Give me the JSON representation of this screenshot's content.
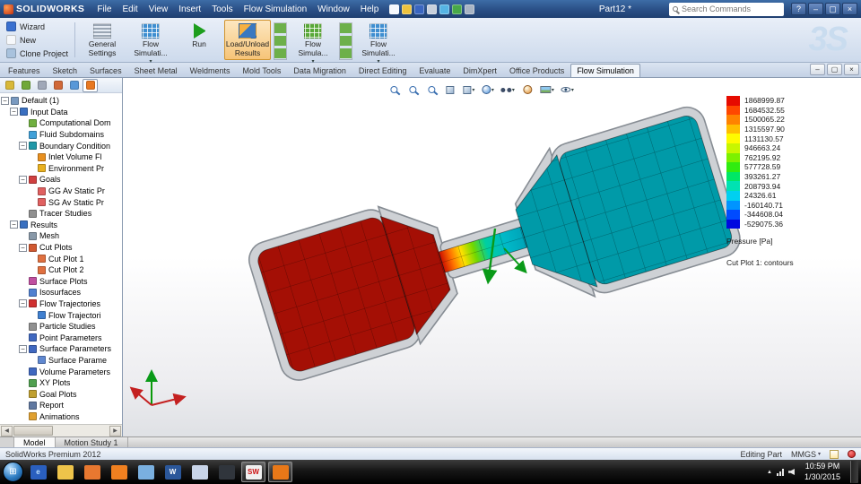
{
  "titlebar": {
    "logo_text": "SOLIDWORKS",
    "menus": [
      {
        "label": "File"
      },
      {
        "label": "Edit"
      },
      {
        "label": "View"
      },
      {
        "label": "Insert"
      },
      {
        "label": "Tools"
      },
      {
        "label": "Flow Simulation"
      },
      {
        "label": "Window"
      },
      {
        "label": "Help"
      }
    ],
    "quick_icons": [
      {
        "name": "new-document-icon",
        "color": "#f6f9fd"
      },
      {
        "name": "open-icon",
        "color": "#eec33e"
      },
      {
        "name": "save-icon",
        "color": "#3a66c0"
      },
      {
        "name": "print-icon",
        "color": "#c8d0dc"
      },
      {
        "name": "undo-icon",
        "color": "#56b4e4"
      },
      {
        "name": "rebuild-icon",
        "color": "#48a848"
      },
      {
        "name": "options-icon",
        "color": "#a8b4c4"
      }
    ],
    "doc_title": "Part12 *",
    "search_placeholder": "Search Commands",
    "window_buttons": [
      {
        "label": "?",
        "name": "help-button"
      },
      {
        "label": "–",
        "name": "minimize-button"
      },
      {
        "label": "▢",
        "name": "maximize-button"
      },
      {
        "label": "×",
        "name": "close-button"
      }
    ]
  },
  "ribbon": {
    "watermark": "3S",
    "small_buttons": [
      {
        "label": "Wizard",
        "name": "wizard-button",
        "color": "#3a70d0"
      },
      {
        "label": "New",
        "name": "new-project-button",
        "color": "#f6f8fb"
      },
      {
        "label": "Clone Project",
        "name": "clone-project-button",
        "color": "#a8c2dd"
      }
    ],
    "items": [
      {
        "label": "General Settings",
        "name": "general-settings-button",
        "type": "rset"
      },
      {
        "label": "Flow Simulati...",
        "name": "flow-simulation-features-button",
        "type": "rgrid",
        "dropdown": true
      },
      {
        "label": "Run",
        "name": "run-button",
        "type": "rrun"
      },
      {
        "label": "Load/Unload Results",
        "name": "load-unload-results-button",
        "type": "rres",
        "active": true
      },
      {
        "label": "",
        "name": "conditions-icon-stack",
        "type": "rstack"
      },
      {
        "label": "Flow Simula...",
        "name": "flow-simulation-display-button",
        "type": "rgrid2",
        "dropdown": true
      },
      {
        "label": "",
        "name": "goals-icon-stack",
        "type": "rstack"
      },
      {
        "label": "Flow Simulati...",
        "name": "flow-simulation-results-button",
        "type": "rgrid",
        "dropdown": true
      }
    ]
  },
  "tabs": {
    "items": [
      {
        "label": "Features"
      },
      {
        "label": "Sketch"
      },
      {
        "label": "Surfaces"
      },
      {
        "label": "Sheet Metal"
      },
      {
        "label": "Weldments"
      },
      {
        "label": "Mold Tools"
      },
      {
        "label": "Data Migration"
      },
      {
        "label": "Direct Editing"
      },
      {
        "label": "Evaluate"
      },
      {
        "label": "DimXpert"
      },
      {
        "label": "Office Products"
      },
      {
        "label": "Flow Simulation",
        "active": true
      }
    ],
    "window_buttons": [
      {
        "label": "–",
        "name": "doc-minimize-button"
      },
      {
        "label": "▢",
        "name": "doc-restore-button"
      },
      {
        "label": "×",
        "name": "doc-close-button"
      }
    ]
  },
  "tree": {
    "icon_tabs": [
      {
        "name": "featuremanager-tab",
        "color": "#d8b838"
      },
      {
        "name": "propertymanager-tab",
        "color": "#70a838"
      },
      {
        "name": "configurationmanager-tab",
        "color": "#a0a8b8"
      },
      {
        "name": "dimxpertmanager-tab",
        "color": "#d06838"
      },
      {
        "name": "displaymanager-tab",
        "color": "#5898d8"
      },
      {
        "name": "flow-simulation-tab",
        "color": "#e87820",
        "active": true
      }
    ],
    "items": [
      {
        "label": "Default (1)",
        "level": 0,
        "toggle": "minus",
        "color": "#7a9ac0"
      },
      {
        "label": "Input Data",
        "level": 1,
        "toggle": "minus",
        "color": "#3a70c0"
      },
      {
        "label": "Computational Dom",
        "level": 2,
        "color": "#70b040"
      },
      {
        "label": "Fluid Subdomains",
        "level": 2,
        "color": "#40a0d8"
      },
      {
        "label": "Boundary Condition",
        "level": 2,
        "toggle": "minus",
        "color": "#2098a8"
      },
      {
        "label": "Inlet Volume Fl",
        "level": 3,
        "color": "#e89020"
      },
      {
        "label": "Environment Pr",
        "level": 3,
        "color": "#e8b020"
      },
      {
        "label": "Goals",
        "level": 2,
        "toggle": "minus",
        "color": "#d04040"
      },
      {
        "label": "GG Av Static Pr",
        "level": 3,
        "color": "#e06060"
      },
      {
        "label": "SG Av Static Pr",
        "level": 3,
        "color": "#e06060"
      },
      {
        "label": "Tracer Studies",
        "level": 2,
        "color": "#909090"
      },
      {
        "label": "Results",
        "level": 1,
        "toggle": "minus",
        "color": "#3a70c0"
      },
      {
        "label": "Mesh",
        "level": 2,
        "color": "#8898a8"
      },
      {
        "label": "Cut Plots",
        "level": 2,
        "toggle": "minus",
        "color": "#d05830"
      },
      {
        "label": "Cut Plot 1",
        "level": 3,
        "color": "#e07040"
      },
      {
        "label": "Cut Plot 2",
        "level": 3,
        "color": "#e07040"
      },
      {
        "label": "Surface Plots",
        "level": 2,
        "color": "#c050a0"
      },
      {
        "label": "Isosurfaces",
        "level": 2,
        "color": "#5080d0"
      },
      {
        "label": "Flow Trajectories",
        "level": 2,
        "toggle": "minus",
        "color": "#d03030"
      },
      {
        "label": "Flow Trajectori",
        "level": 3,
        "color": "#4080d0"
      },
      {
        "label": "Particle Studies",
        "level": 2,
        "color": "#909090"
      },
      {
        "label": "Point Parameters",
        "level": 2,
        "color": "#4068c0"
      },
      {
        "label": "Surface Parameters",
        "level": 2,
        "toggle": "minus",
        "color": "#4068c0"
      },
      {
        "label": "Surface Parame",
        "level": 3,
        "color": "#6088d0"
      },
      {
        "label": "Volume Parameters",
        "level": 2,
        "color": "#4068c0"
      },
      {
        "label": "XY Plots",
        "level": 2,
        "color": "#50a050"
      },
      {
        "label": "Goal Plots",
        "level": 2,
        "color": "#c0a030"
      },
      {
        "label": "Report",
        "level": 2,
        "color": "#6078a0"
      },
      {
        "label": "Animations",
        "level": 2,
        "color": "#e0a030"
      }
    ]
  },
  "viewport": {
    "toolbar": [
      {
        "name": "zoom-fit-icon",
        "type": "mag"
      },
      {
        "name": "zoom-area-icon",
        "type": "mag"
      },
      {
        "name": "previous-view-icon",
        "type": "mag"
      },
      {
        "name": "section-view-icon",
        "type": "cube"
      },
      {
        "name": "view-orientation-icon",
        "type": "cube",
        "dropdown": true
      },
      {
        "name": "display-style-icon",
        "type": "ball",
        "dropdown": true
      },
      {
        "name": "hide-show-items-icon",
        "type": "glasses",
        "dropdown": true
      },
      {
        "name": "edit-appearance-icon",
        "type": "ball2"
      },
      {
        "name": "apply-scene-icon",
        "type": "photo",
        "dropdown": true
      },
      {
        "name": "view-settings-icon",
        "type": "eye",
        "dropdown": true
      }
    ],
    "legend": {
      "rows": [
        {
          "label": "1868999.87",
          "color": "#e60b00"
        },
        {
          "label": "1684532.55",
          "color": "#ff4700"
        },
        {
          "label": "1500065.22",
          "color": "#ff8300"
        },
        {
          "label": "1315597.90",
          "color": "#ffbf00"
        },
        {
          "label": "1131130.57",
          "color": "#fffb00"
        },
        {
          "label": "946663.24",
          "color": "#c8f600"
        },
        {
          "label": "762195.92",
          "color": "#7cf100"
        },
        {
          "label": "577728.59",
          "color": "#30ec10"
        },
        {
          "label": "393261.27",
          "color": "#00e766"
        },
        {
          "label": "208793.94",
          "color": "#00e2b2"
        },
        {
          "label": "24326.61",
          "color": "#00d0f0"
        },
        {
          "label": "-160140.71",
          "color": "#0094ff"
        },
        {
          "label": "-344608.04",
          "color": "#004bff"
        },
        {
          "label": "-529075.36",
          "color": "#0008e0"
        }
      ],
      "label": "Pressure [Pa]",
      "sublabel": "Cut Plot 1: contours"
    }
  },
  "bottom": {
    "tabs": [
      {
        "label": "Model",
        "active": true
      },
      {
        "label": "Motion Study 1"
      }
    ]
  },
  "statusbar": {
    "left": "SolidWorks Premium 2012",
    "editing": "Editing Part",
    "units": "MMGS"
  },
  "taskbar": {
    "icons": [
      {
        "name": "internet-explorer-icon",
        "glyph": "e",
        "bg": "#2a5fbf",
        "fg": "#bfe2ff"
      },
      {
        "name": "windows-explorer-icon",
        "glyph": "",
        "bg": "#eec44a",
        "fg": "#806010"
      },
      {
        "name": "media-player-icon",
        "glyph": "",
        "bg": "#e87830",
        "fg": "#fff"
      },
      {
        "name": "firefox-icon",
        "glyph": "",
        "bg": "#f08020",
        "fg": "#fff"
      },
      {
        "name": "libraries-icon",
        "glyph": "",
        "bg": "#7ab0e0",
        "fg": "#fff"
      },
      {
        "name": "word-icon",
        "glyph": "W",
        "bg": "#2b579a",
        "fg": "#fff"
      },
      {
        "name": "mail-icon",
        "glyph": "",
        "bg": "#c8d4e8",
        "fg": "#345"
      },
      {
        "name": "vlc-icon",
        "glyph": "",
        "bg": "#30353c",
        "fg": "#e87820"
      },
      {
        "name": "solidworks-icon",
        "glyph": "SW",
        "bg": "#f0f0f0",
        "fg": "#cc1010",
        "active": true
      },
      {
        "name": "flow-simulation-icon",
        "glyph": "",
        "bg": "#e87818",
        "fg": "#fff",
        "active": true
      }
    ],
    "time": "10:59 PM",
    "date": "1/30/2015"
  }
}
